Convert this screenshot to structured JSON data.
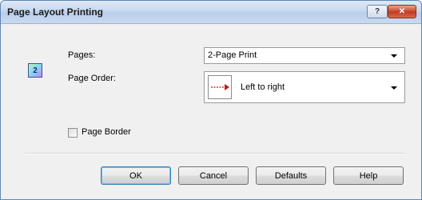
{
  "window": {
    "title": "Page Layout Printing"
  },
  "titlebar_buttons": {
    "help": "?",
    "close": "✕"
  },
  "icon": {
    "glyph": "2",
    "name": "page-layout-icon"
  },
  "pages": {
    "label": "Pages:",
    "selected": "2-Page Print"
  },
  "page_order": {
    "label": "Page Order:",
    "selected": "Left to right"
  },
  "page_border": {
    "label": "Page Border",
    "checked": false
  },
  "buttons": {
    "ok": "OK",
    "cancel": "Cancel",
    "defaults": "Defaults",
    "help": "Help"
  }
}
